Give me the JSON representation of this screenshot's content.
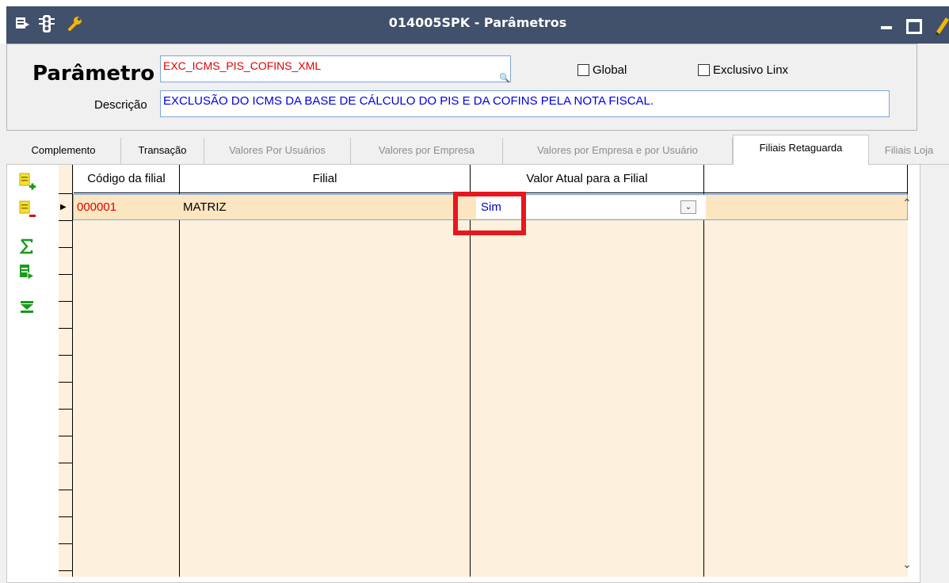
{
  "window": {
    "title": "014005SPK - Parâmetros"
  },
  "header": {
    "param_label": "Parâmetro",
    "param_value": "EXC_ICMS_PIS_COFINS_XML",
    "global_label": "Global",
    "exclusivo_label": "Exclusivo Linx",
    "desc_label": "Descrição",
    "desc_value": "EXCLUSÃO DO ICMS DA BASE DE CÁLCULO DO PIS E DA COFINS PELA NOTA FISCAL."
  },
  "tabs": [
    {
      "label": "Complemento",
      "state": "enabled"
    },
    {
      "label": "Transação",
      "state": "enabled"
    },
    {
      "label": "Valores Por Usuários",
      "state": "disabled"
    },
    {
      "label": "Valores por Empresa",
      "state": "disabled"
    },
    {
      "label": "Valores por Empresa e por Usuário",
      "state": "disabled"
    },
    {
      "label": "Filiais Retaguarda",
      "state": "active"
    },
    {
      "label": "Filiais Loja",
      "state": "disabled"
    }
  ],
  "grid": {
    "columns": [
      "Código da filial",
      "Filial",
      "Valor Atual para a Filial",
      ""
    ],
    "rows": [
      {
        "codigo": "000001",
        "filial": "MATRIZ",
        "valor": "Sim"
      }
    ]
  },
  "toolbar_icons": [
    "add-row-icon",
    "remove-row-icon",
    "sum-icon",
    "export-icon",
    "expand-icon"
  ],
  "colors": {
    "titlebar": "#41506b",
    "grid_background": "#fdf0dc",
    "highlight": "#e8161e",
    "param_value": "#e00000",
    "desc_value": "#0000e0"
  }
}
